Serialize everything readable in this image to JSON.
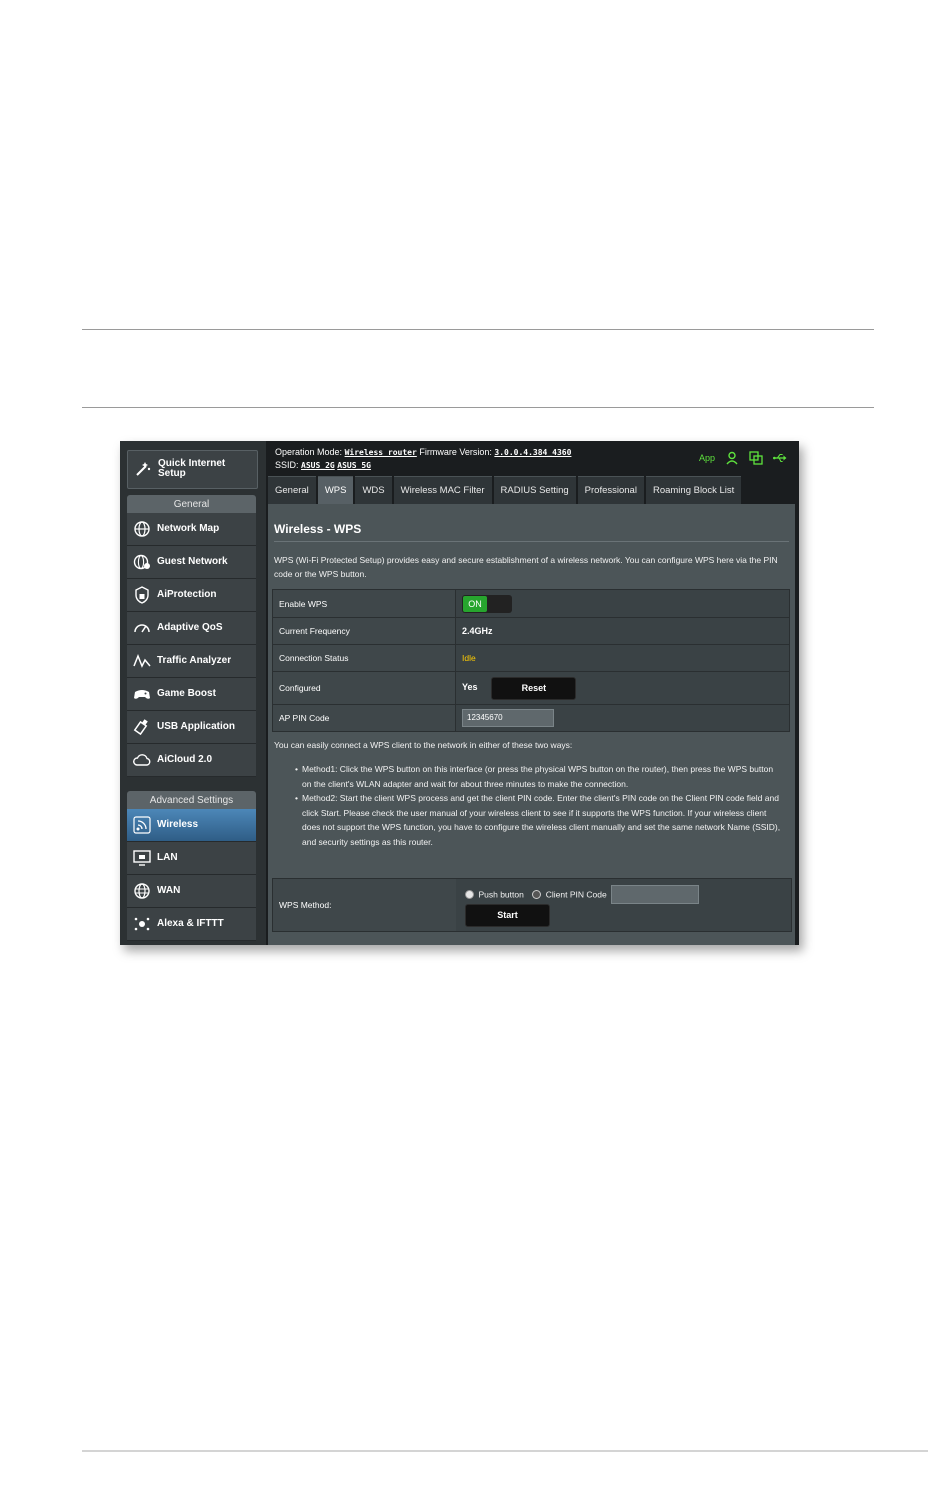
{
  "sidebar": {
    "quick_setup": "Quick Internet Setup",
    "general_header": "General",
    "general_items": [
      "Network Map",
      "Guest Network",
      "AiProtection",
      "Adaptive QoS",
      "Traffic Analyzer",
      "Game Boost",
      "USB Application",
      "AiCloud 2.0"
    ],
    "advanced_header": "Advanced Settings",
    "advanced_items": [
      "Wireless",
      "LAN",
      "WAN",
      "Alexa & IFTTT"
    ],
    "active_item": "Wireless"
  },
  "header": {
    "operation_mode_label": "Operation Mode:",
    "operation_mode_value": "Wireless router",
    "firmware_label": "Firmware Version:",
    "firmware_value": "3.0.0.4.384_4360",
    "ssid_label": "SSID:",
    "ssid_1": "ASUS_2G",
    "ssid_2": "ASUS_5G",
    "app_label": "App",
    "accent_color": "#5ee33d"
  },
  "tabs": [
    "General",
    "WPS",
    "WDS",
    "Wireless MAC Filter",
    "RADIUS Setting",
    "Professional",
    "Roaming Block List"
  ],
  "active_tab": "WPS",
  "page": {
    "title": "Wireless - WPS",
    "description": "WPS (Wi-Fi Protected Setup) provides easy and secure establishment of a wireless network. You can configure WPS here via the PIN code or the WPS button.",
    "enable_wps_label": "Enable WPS",
    "toggle_on": "ON",
    "frequency_label": "Current Frequency",
    "frequency_value": "2.4GHz",
    "status_label": "Connection Status",
    "status_value": "Idle",
    "configured_label": "Configured",
    "configured_value": "Yes",
    "reset_label": "Reset",
    "pin_label": "AP PIN Code",
    "pin_value": "12345670",
    "intro": "You can easily connect a WPS client to the network in either of these two ways:",
    "method1": "Method1: Click the WPS button on this interface (or press the physical WPS button on the router), then press the WPS button on the client's WLAN adapter and wait for about three minutes to make the connection.",
    "method2": "Method2: Start the client WPS process and get the client PIN code. Enter the client's PIN code on the Client PIN code field and click Start. Please check the user manual of your wireless client to see if it supports the WPS function. If your wireless client does not support the WPS function, you have to configure the wireless client manually and set the same network Name (SSID), and security settings as this router.",
    "wps_method_label": "WPS Method:",
    "push_button_label": "Push button",
    "client_pin_label": "Client PIN Code",
    "start_label": "Start"
  }
}
